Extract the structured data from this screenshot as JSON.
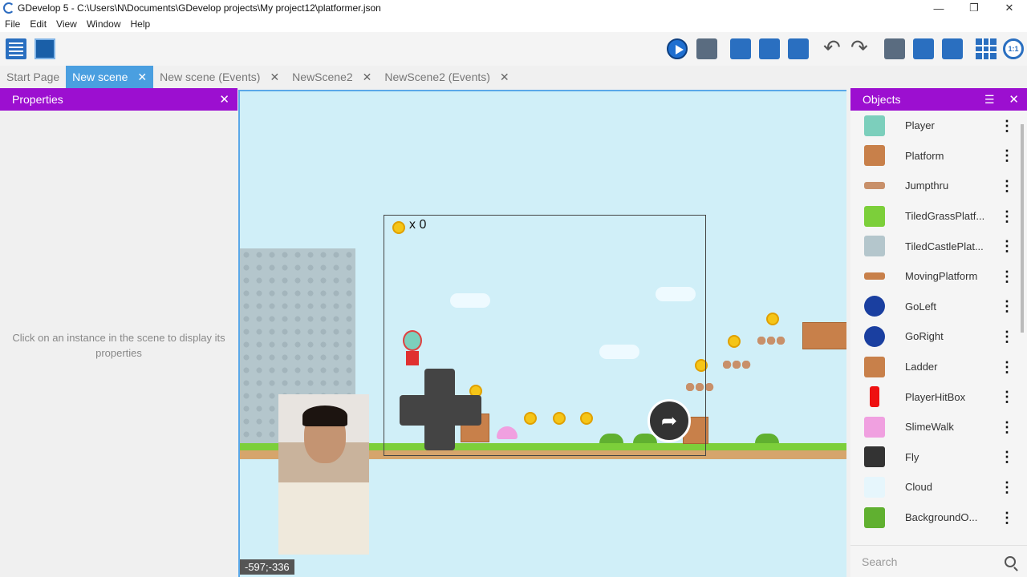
{
  "window": {
    "title": "GDevelop 5 - C:\\Users\\N\\Documents\\GDevelop projects\\My project12\\platformer.json",
    "minimize": "—",
    "maximize": "❐",
    "close": "✕"
  },
  "menu": [
    "File",
    "Edit",
    "View",
    "Window",
    "Help"
  ],
  "tabs": [
    {
      "label": "Start Page",
      "closable": false,
      "active": false
    },
    {
      "label": "New scene",
      "closable": true,
      "active": true
    },
    {
      "label": "New scene (Events)",
      "closable": true,
      "active": false
    },
    {
      "label": "NewScene2",
      "closable": true,
      "active": false
    },
    {
      "label": "NewScene2 (Events)",
      "closable": true,
      "active": false
    }
  ],
  "tab_close_glyph": "✕",
  "properties": {
    "title": "Properties",
    "close": "✕",
    "hint": "Click on an instance in the scene to display its properties"
  },
  "scene": {
    "coin_counter": "x 0",
    "coordinates": "-597;-336",
    "jump_glyph": "➦"
  },
  "objects": {
    "title": "Objects",
    "filter": "☰",
    "close": "✕",
    "menu_glyph": "⋮",
    "search_placeholder": "Search",
    "items": [
      {
        "name": "Player",
        "icon": "player-icon",
        "color": "#7ccfbc"
      },
      {
        "name": "Platform",
        "icon": "platform-icon",
        "color": "#c8804a"
      },
      {
        "name": "Jumpthru",
        "icon": "jumpthru-icon",
        "color": "#c8906a"
      },
      {
        "name": "TiledGrassPlatf...",
        "icon": "grass-icon",
        "color": "#7ccf3a"
      },
      {
        "name": "TiledCastlePlat...",
        "icon": "castle-icon",
        "color": "#b4c6cc"
      },
      {
        "name": "MovingPlatform",
        "icon": "moving-platform-icon",
        "color": "#c8804a"
      },
      {
        "name": "GoLeft",
        "icon": "go-left-icon",
        "color": "#1a3fa0"
      },
      {
        "name": "GoRight",
        "icon": "go-right-icon",
        "color": "#1a3fa0"
      },
      {
        "name": "Ladder",
        "icon": "ladder-icon",
        "color": "#c8804a"
      },
      {
        "name": "PlayerHitBox",
        "icon": "hitbox-icon",
        "color": "#ee1111"
      },
      {
        "name": "SlimeWalk",
        "icon": "slime-icon",
        "color": "#f0a0e0"
      },
      {
        "name": "Fly",
        "icon": "fly-icon",
        "color": "#333333"
      },
      {
        "name": "Cloud",
        "icon": "cloud-icon",
        "color": "#e6f6fc"
      },
      {
        "name": "BackgroundO...",
        "icon": "background-icon",
        "color": "#60b030"
      }
    ]
  }
}
